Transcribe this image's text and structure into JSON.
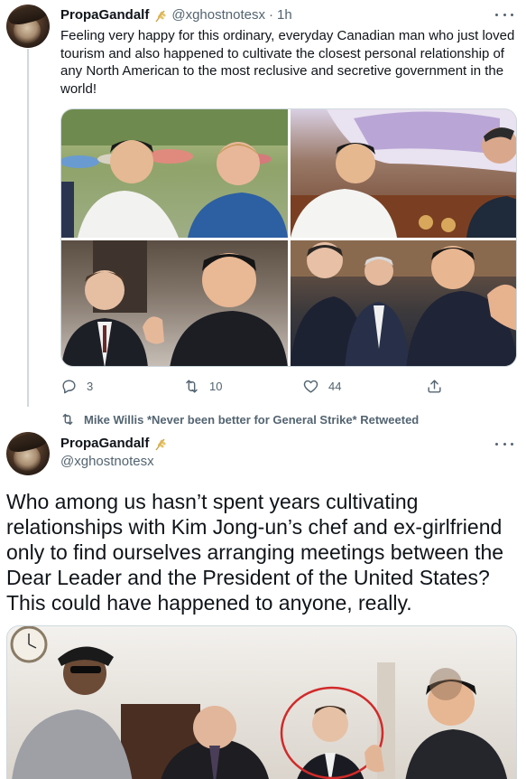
{
  "tweet1": {
    "author_name": "PropaGandalf",
    "handle": "@xghostnotesx",
    "separator": "·",
    "time": "1h",
    "text": "Feeling very happy for this ordinary, everyday Canadian man who just loved tourism and also happened to cultivate the closest personal relationship of any North American to the most reclusive and secretive government in the world!",
    "photo_count": 4,
    "actions": {
      "reply_count": "3",
      "retweet_count": "10",
      "like_count": "44"
    }
  },
  "retweet_banner": {
    "text": "Mike Willis *Never been better for General Strike* Retweeted"
  },
  "tweet2": {
    "author_name": "PropaGandalf",
    "handle": "@xghostnotesx",
    "text": "Who among us hasn’t spent years cultivating relationships with Kim Jong-un’s chef and ex-girlfriend only to find ourselves arranging meetings between the Dear Leader and the President of the United States? This could have happened to anyone, really."
  },
  "colors": {
    "text_primary": "#0f1419",
    "text_secondary": "#536471",
    "border": "#cfd9de",
    "badge": "#c8a24a",
    "highlight_circle": "#d12a2a"
  },
  "icons": [
    "more-icon",
    "reply-icon",
    "retweet-icon",
    "like-icon",
    "share-icon",
    "wheat-badge-icon"
  ]
}
